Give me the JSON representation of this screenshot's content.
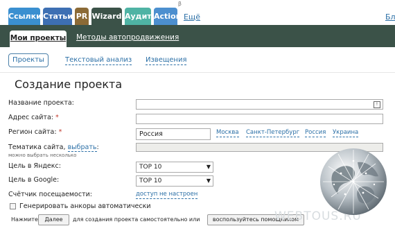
{
  "top_tabs": [
    {
      "label": "Ссылки",
      "color": "#3a8fd0"
    },
    {
      "label": "Статьи",
      "color": "#3d6fb3"
    },
    {
      "label": "PR",
      "color": "#8b6a36"
    },
    {
      "label": "Wizard",
      "color": "#3b5248"
    },
    {
      "label": "Аудит",
      "color": "#4fb3a4"
    },
    {
      "label": "Action",
      "color": "#4c8fcf",
      "superscript": "β"
    },
    {
      "label": "Ещё"
    },
    {
      "label": "Бл"
    }
  ],
  "nav": {
    "active": "Мои проекты",
    "other": "Методы автопродвижения"
  },
  "subtabs": [
    "Проекты",
    "Текстовый анализ",
    "Извещения"
  ],
  "page_title": "Создание проекта",
  "form": {
    "name_label": "Название проекта:",
    "url_label": "Адрес сайта:",
    "region_label": "Регион сайта:",
    "region_value": "Россия",
    "region_links": [
      "Москва",
      "Санкт-Петербург",
      "Россия",
      "Украина"
    ],
    "topic_label": "Тематика сайта,",
    "topic_link": "выбрать",
    "topic_colon": ":",
    "topic_note": "можно выбрать несколько",
    "yandex_label": "Цель в Яндекс:",
    "yandex_value": "TOP 10",
    "google_label": "Цель в Google:",
    "google_value": "TOP 10",
    "counter_label": "Счётчик посещаемости:",
    "counter_link": "доступ не настроен",
    "anchors_label": "Генерировать анкоры автоматически",
    "required_mark": "*",
    "select_arrow": "▼"
  },
  "bottom": {
    "press": "Нажмите",
    "next_button": "Далее",
    "middle_text": "для создания проекта самостоятельно или",
    "help_button": "воспользуйтесь помощником"
  },
  "watermark": "WEBTOUS.RU"
}
